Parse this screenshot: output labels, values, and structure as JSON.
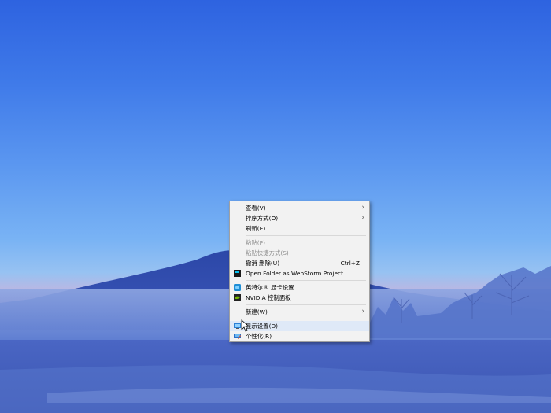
{
  "context_menu": {
    "items": [
      {
        "label": "查看(V)",
        "submenu": true
      },
      {
        "label": "排序方式(O)",
        "submenu": true
      },
      {
        "label": "刷新(E)"
      },
      {
        "label": "粘贴(P)",
        "disabled": true
      },
      {
        "label": "粘贴快捷方式(S)",
        "disabled": true
      },
      {
        "label": "撤消 删除(U)",
        "shortcut": "Ctrl+Z"
      },
      {
        "label": "Open Folder as WebStorm Project",
        "icon": "webstorm-icon"
      },
      {
        "label": "英特尔® 显卡设置",
        "icon": "intel-graphics-icon"
      },
      {
        "label": "NVIDIA 控制面板",
        "icon": "nvidia-icon"
      },
      {
        "label": "新建(W)",
        "submenu": true
      },
      {
        "label": "显示设置(D)",
        "icon": "display-settings-icon"
      },
      {
        "label": "个性化(R)",
        "icon": "personalize-icon"
      }
    ]
  },
  "colors": {
    "menu_background": "#f2f2f2",
    "disabled_text": "#8d8d8d",
    "highlight": "#dfe9f7"
  }
}
